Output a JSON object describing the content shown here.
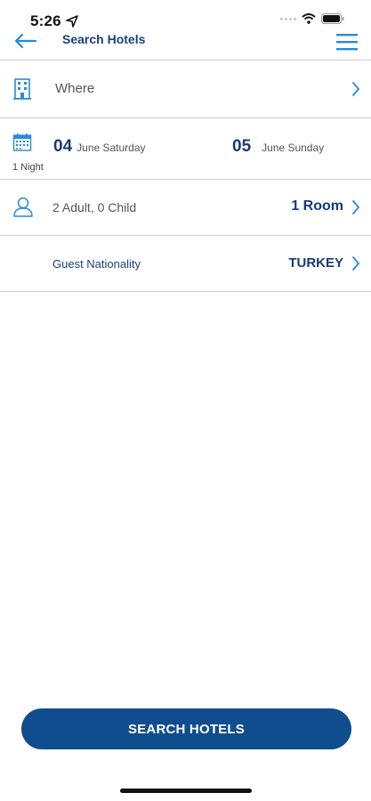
{
  "status_bar": {
    "time": "5:26"
  },
  "nav": {
    "title": "Search Hotels"
  },
  "where": {
    "label": "Where"
  },
  "dates": {
    "checkin_day": "04",
    "checkin_text": "June Saturday",
    "checkout_day": "05",
    "checkout_text": "June Sunday",
    "nights": "1 Night"
  },
  "guests": {
    "label": "2 Adult, 0 Child",
    "rooms": "1 Room"
  },
  "nationality": {
    "label": "Guest Nationality",
    "value": "TURKEY"
  },
  "search_button": {
    "label": "SEARCH HOTELS"
  },
  "colors": {
    "brand": "#104d8e",
    "accent": "#2a8ad6",
    "text_blue": "#173a7a"
  }
}
